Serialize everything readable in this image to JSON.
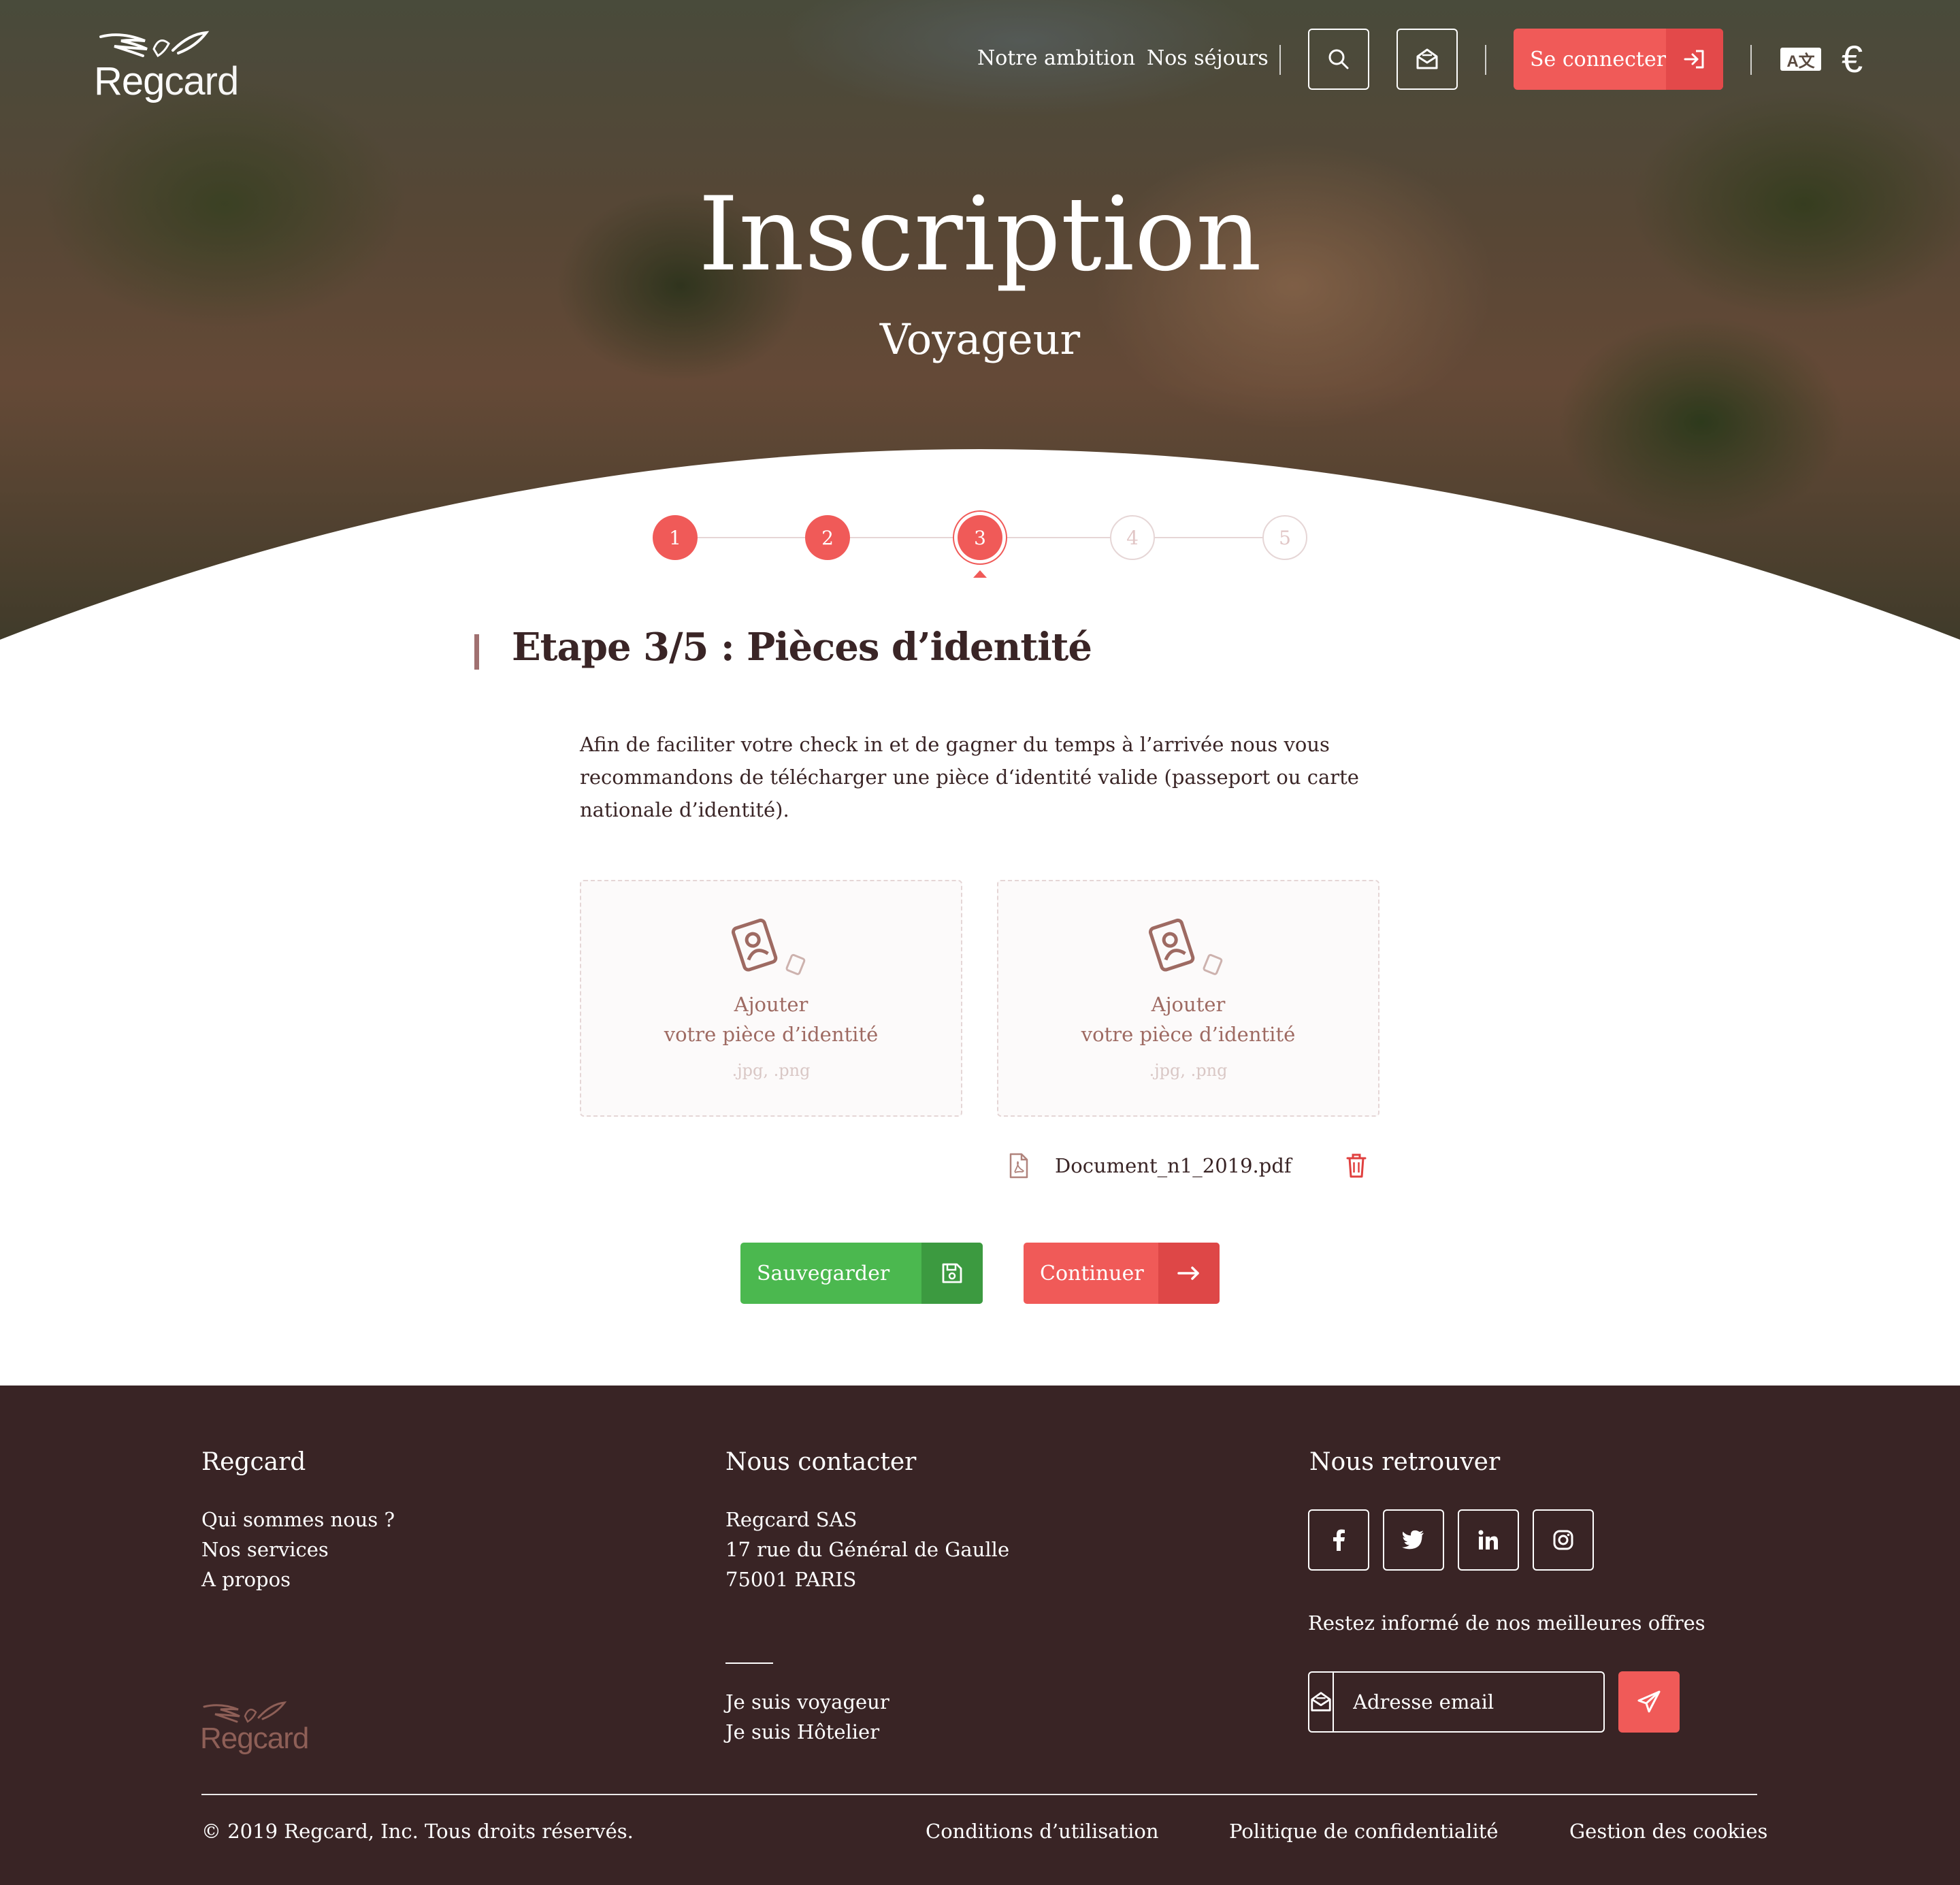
{
  "header": {
    "logo_text_bold": "Reg",
    "logo_text_light": "card",
    "nav": [
      "Notre ambition",
      "Nos séjours"
    ],
    "login_label": "Se connecter",
    "currency_symbol": "€",
    "language_icon_text": "A文"
  },
  "hero": {
    "title": "Inscription",
    "subtitle": "Voyageur"
  },
  "stepper": {
    "steps": [
      "1",
      "2",
      "3",
      "4",
      "5"
    ],
    "current": 3
  },
  "form": {
    "step_title": "Etape 3/5 : Pièces d’identité",
    "intro": "Afin de faciliter votre check in et de gagner du temps à l’arrivée nous vous recommandons de télécharger une pièce d‘identité valide (passeport ou carte nationale d’identité).",
    "dropzones": [
      {
        "line1": "Ajouter",
        "line2": "votre pièce d’identité",
        "formats": ".jpg, .png"
      },
      {
        "line1": "Ajouter",
        "line2": "votre pièce d’identité",
        "formats": ".jpg, .png"
      }
    ],
    "uploaded_file": "Document_n1_2019.pdf",
    "save_label": "Sauvegarder",
    "continue_label": "Continuer"
  },
  "footer": {
    "col1": {
      "title": "Regcard",
      "links": [
        "Qui sommes nous ?",
        "Nos services",
        "A propos"
      ]
    },
    "col2": {
      "title": "Nous contacter",
      "address": [
        "Regcard SAS",
        "17 rue du Général de Gaulle",
        "75001 PARIS"
      ],
      "links": [
        "Je suis voyageur",
        "Je suis Hôtelier"
      ]
    },
    "col3": {
      "title": "Nous retrouver",
      "socials": [
        "facebook-icon",
        "twitter-icon",
        "linkedin-icon",
        "instagram-icon"
      ],
      "newsletter_text": "Restez informé de nos meilleures offres",
      "email_placeholder": "Adresse email"
    },
    "copyright": "© 2019 Regcard, Inc. Tous droits réservés.",
    "bottom_links": [
      "Conditions d’utilisation",
      "Politique de confidentialité",
      "Gestion des cookies"
    ]
  },
  "colors": {
    "accent": "#f05a58",
    "success": "#4bb84f",
    "footer_bg": "#392425",
    "text_dark": "#3a2526"
  }
}
